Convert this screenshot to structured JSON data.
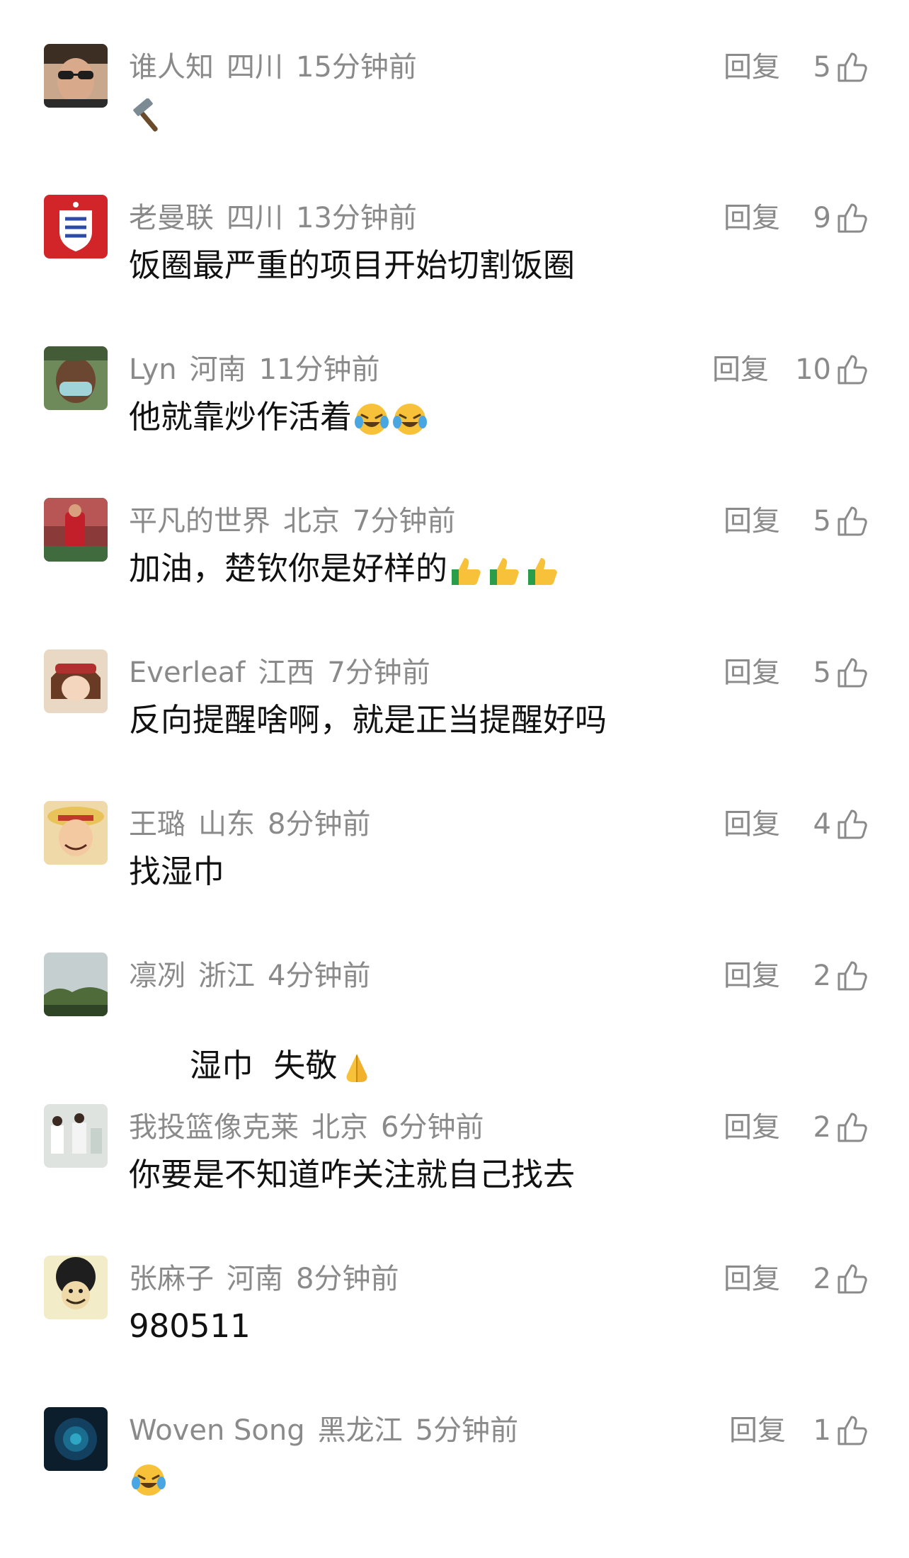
{
  "ui": {
    "reply_label": "回复"
  },
  "comments": [
    {
      "username": "谁人知",
      "location": "四川",
      "time": "15分钟前",
      "text": "",
      "emojis": [
        "hammer-emoji"
      ],
      "likes": "5"
    },
    {
      "username": "老曼联",
      "location": "四川",
      "time": "13分钟前",
      "text": "饭圈最严重的项目开始切割饭圈",
      "emojis": [],
      "likes": "9"
    },
    {
      "username": "Lyn",
      "location": "河南",
      "time": "11分钟前",
      "text": "他就靠炒作活着",
      "emojis": [
        "laughing-crying-emoji",
        "laughing-crying-emoji"
      ],
      "likes": "10"
    },
    {
      "username": "平凡的世界",
      "location": "北京",
      "time": "7分钟前",
      "text": "加油，楚钦你是好样的",
      "emojis": [
        "thumbs-up-emoji",
        "thumbs-up-emoji",
        "thumbs-up-emoji"
      ],
      "likes": "5"
    },
    {
      "username": "Everleaf",
      "location": "江西",
      "time": "7分钟前",
      "text": "反向提醒啥啊，就是正当提醒好吗",
      "emojis": [],
      "likes": "5"
    },
    {
      "username": "王璐",
      "location": "山东",
      "time": "8分钟前",
      "text": "找湿巾",
      "emojis": [],
      "likes": "4"
    },
    {
      "username": "凛冽",
      "location": "浙江",
      "time": "4分钟前",
      "text": "湿巾  失敬",
      "emojis": [
        "folded-hands-emoji"
      ],
      "likes": "2"
    },
    {
      "username": "我投篮像克莱",
      "location": "北京",
      "time": "6分钟前",
      "text": "你要是不知道咋关注就自己找去",
      "emojis": [],
      "likes": "2"
    },
    {
      "username": "张麻子",
      "location": "河南",
      "time": "8分钟前",
      "text": "980511",
      "emojis": [],
      "likes": "2"
    },
    {
      "username": "Woven Song",
      "location": "黑龙江",
      "time": "5分钟前",
      "text": "",
      "emojis": [
        "laughing-crying-emoji"
      ],
      "likes": "1"
    }
  ],
  "colors": {
    "meta_gray": "#8a8a8a",
    "text_black": "#111111",
    "background": "#ffffff"
  }
}
